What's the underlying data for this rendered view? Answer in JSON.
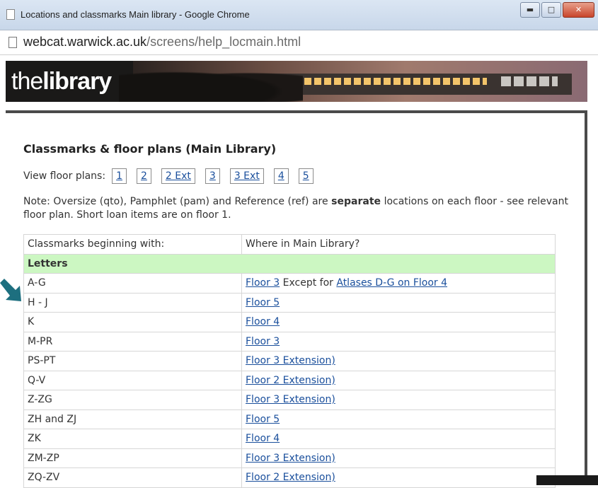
{
  "window": {
    "title": "Locations and classmarks Main library - Google Chrome",
    "controls": {
      "minimize": "▬",
      "maximize": "□",
      "close": "✕"
    }
  },
  "address": {
    "host": "webcat.warwick.ac.uk",
    "path": "/screens/help_locmain.html"
  },
  "banner": {
    "logo_light": "the",
    "logo_bold": "library"
  },
  "page": {
    "heading": "Classmarks & floor plans  (Main Library)",
    "floors_label": "View floor plans:",
    "floors": [
      "1",
      "2",
      "2 Ext",
      "3",
      "3 Ext",
      "4",
      "5"
    ],
    "note_pre": "Note: Oversize (qto), Pamphlet (pam) and Reference (ref) are ",
    "note_bold": "separate",
    "note_post": " locations on each floor - see relevant floor plan. Short loan items are on floor 1."
  },
  "table": {
    "headers": [
      "Classmarks beginning with:",
      "Where in Main Library?"
    ],
    "section": "Letters",
    "rows": [
      {
        "classmark": "A-G",
        "link": "Floor 3",
        "extra": " Except for ",
        "link2": "Atlases D-G on Floor 4"
      },
      {
        "classmark": "H - J",
        "link": "Floor 5"
      },
      {
        "classmark": "K",
        "link": "Floor 4"
      },
      {
        "classmark": "M-PR",
        "link": "Floor 3"
      },
      {
        "classmark": "PS-PT",
        "link": "Floor 3 Extension)"
      },
      {
        "classmark": "Q-V",
        "link": "Floor 2 Extension)"
      },
      {
        "classmark": "Z-ZG",
        "link": "Floor 3 Extension)"
      },
      {
        "classmark": "ZH and ZJ",
        "link": "Floor 5"
      },
      {
        "classmark": "ZK",
        "link": "Floor 4"
      },
      {
        "classmark": "ZM-ZP",
        "link": "Floor 3 Extension)"
      },
      {
        "classmark": "ZQ-ZV",
        "link": "Floor 2 Extension)"
      }
    ]
  },
  "colors": {
    "section_bg": "#ccf7c2",
    "link": "#1a4f9c",
    "arrow": "#1d6f7f"
  }
}
